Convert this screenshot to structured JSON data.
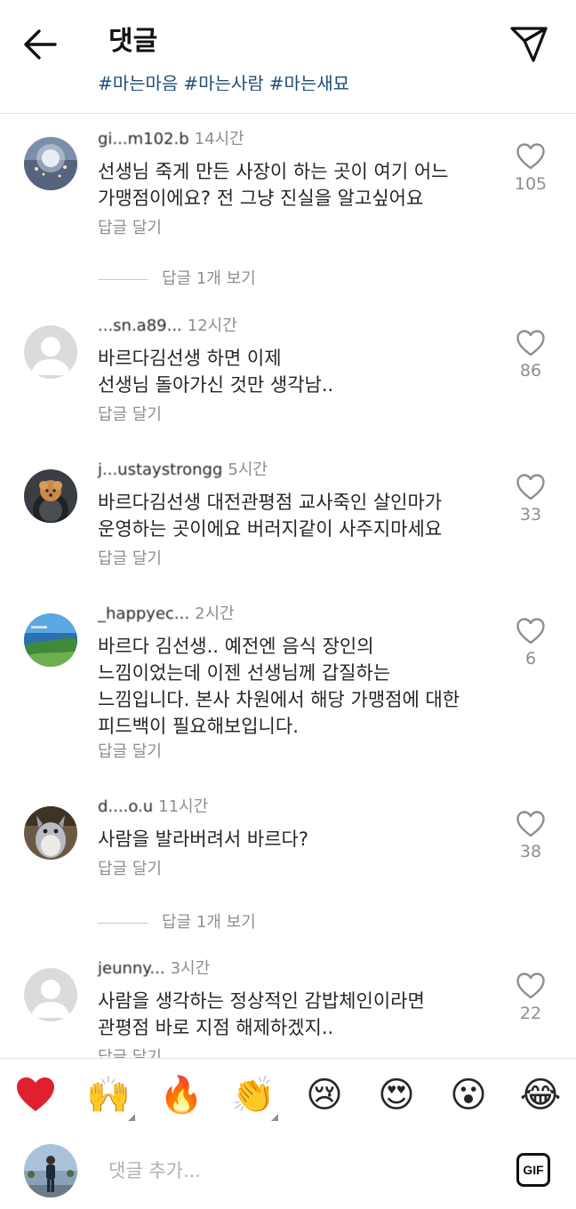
{
  "header": {
    "title": "댓글",
    "hashtags": [
      "#마는마음",
      "#마는사람",
      "#마는새묘"
    ]
  },
  "comments": [
    {
      "username": "gi...m102.b",
      "time": "14시간",
      "lines": [
        "선생님 죽게 만든 사장이 하는 곳이 여기 어느",
        "가맹점이에요? 전 그냥 진실을 알고싶어요"
      ],
      "reply": "답글 달기",
      "likes": "105"
    },
    {
      "username": "...sn.a89...",
      "time": "12시간",
      "lines": [
        "바르다김선생 하면 이제",
        "선생님 돌아가신 것만 생각남.."
      ],
      "reply": "답글 달기",
      "likes": "86"
    },
    {
      "username": "j...ustaystrongg",
      "time": "5시간",
      "lines": [
        "바르다김선생 대전관평점 교사죽인 살인마가",
        "운영하는 곳이에요 버러지같이 사주지마세요"
      ],
      "reply": "답글 달기",
      "likes": "33"
    },
    {
      "username": "_happyec...",
      "time": "2시간",
      "lines": [
        "바르다 김선생.. 예전엔 음식 장인의",
        "느낌이었는데 이젠 선생님께 갑질하는",
        "느낌입니다. 본사 차원에서 해당 가맹점에 대한",
        "피드백이 필요해보입니다."
      ],
      "reply": "답글 달기",
      "likes": "6"
    },
    {
      "username": "d....o.u",
      "time": "11시간",
      "lines": [
        "사람을 발라버려서 바르다?"
      ],
      "reply": "답글 달기",
      "likes": "38"
    },
    {
      "username": "jeunny...",
      "time": "3시간",
      "lines": [
        "사람을 생각하는 정상적인 감밥체인이라면",
        "관평점 바로 지점 해제하겠지.."
      ],
      "reply": "답글 달기",
      "likes": "22"
    }
  ],
  "view_replies": [
    "답글 1개 보기",
    "답글 1개 보기"
  ],
  "emoji_bar": [
    {
      "icon": "red-heart",
      "glyph": "❤️"
    },
    {
      "icon": "raising-hands",
      "glyph": "🙌"
    },
    {
      "icon": "fire",
      "glyph": "🔥"
    },
    {
      "icon": "clapping-hands",
      "glyph": "👏"
    },
    {
      "icon": "crying-face",
      "glyph": "😢"
    },
    {
      "icon": "heart-eyes",
      "glyph": "😍"
    },
    {
      "icon": "surprised-face",
      "glyph": "😮"
    },
    {
      "icon": "tears-of-joy",
      "glyph": "😂"
    }
  ],
  "composer": {
    "placeholder": "댓글 추가...",
    "gif_label": "GIF"
  }
}
